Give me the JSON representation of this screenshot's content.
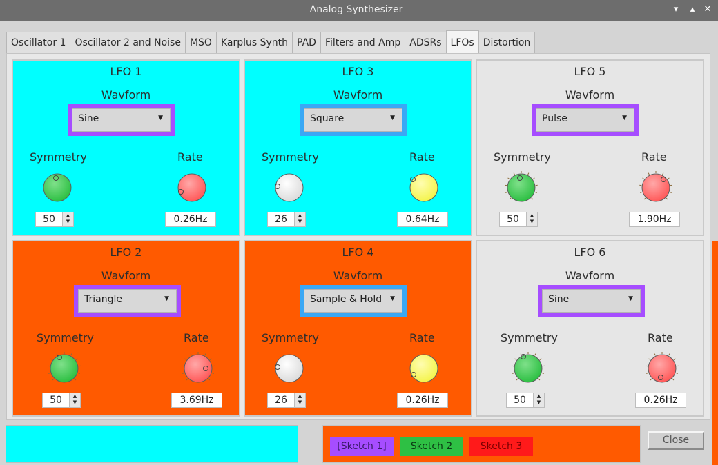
{
  "window": {
    "title": "Analog Synthesizer",
    "minimize": "▾",
    "maximize": "▴",
    "close": "✕"
  },
  "tabs": [
    "Oscillator 1",
    "Oscillator 2 and Noise",
    "MSO",
    "Karplus Synth",
    "PAD",
    "Filters and Amp",
    "ADSRs",
    "LFOs",
    "Distortion"
  ],
  "active_tab": "LFOs",
  "waveform_label": "Wavform",
  "symmetry_label": "Symmetry",
  "rate_label": "Rate",
  "lfos": [
    {
      "title": "LFO 1",
      "waveform": "Sine",
      "symmetry": "50",
      "rate": "0.26Hz"
    },
    {
      "title": "LFO 3",
      "waveform": "Square",
      "symmetry": "26",
      "rate": "0.64Hz"
    },
    {
      "title": "LFO 5",
      "waveform": "Pulse",
      "symmetry": "50",
      "rate": "1.90Hz"
    },
    {
      "title": "LFO 2",
      "waveform": "Triangle",
      "symmetry": "50",
      "rate": "3.69Hz"
    },
    {
      "title": "LFO 4",
      "waveform": "Sample & Hold",
      "symmetry": "26",
      "rate": "0.26Hz"
    },
    {
      "title": "LFO 6",
      "waveform": "Sine",
      "symmetry": "50",
      "rate": "0.26Hz"
    }
  ],
  "sketch_buttons": [
    "[Sketch 1]",
    "Sketch 2",
    "Sketch 3"
  ],
  "close_label": "Close",
  "colors": {
    "cyan": "#00ffff",
    "orange": "#ff5a00",
    "gray": "#e6e6e6",
    "purple": "#a64dff",
    "blue": "#3aa8f5",
    "green": "#2ec044",
    "red": "#ff1a1a"
  }
}
